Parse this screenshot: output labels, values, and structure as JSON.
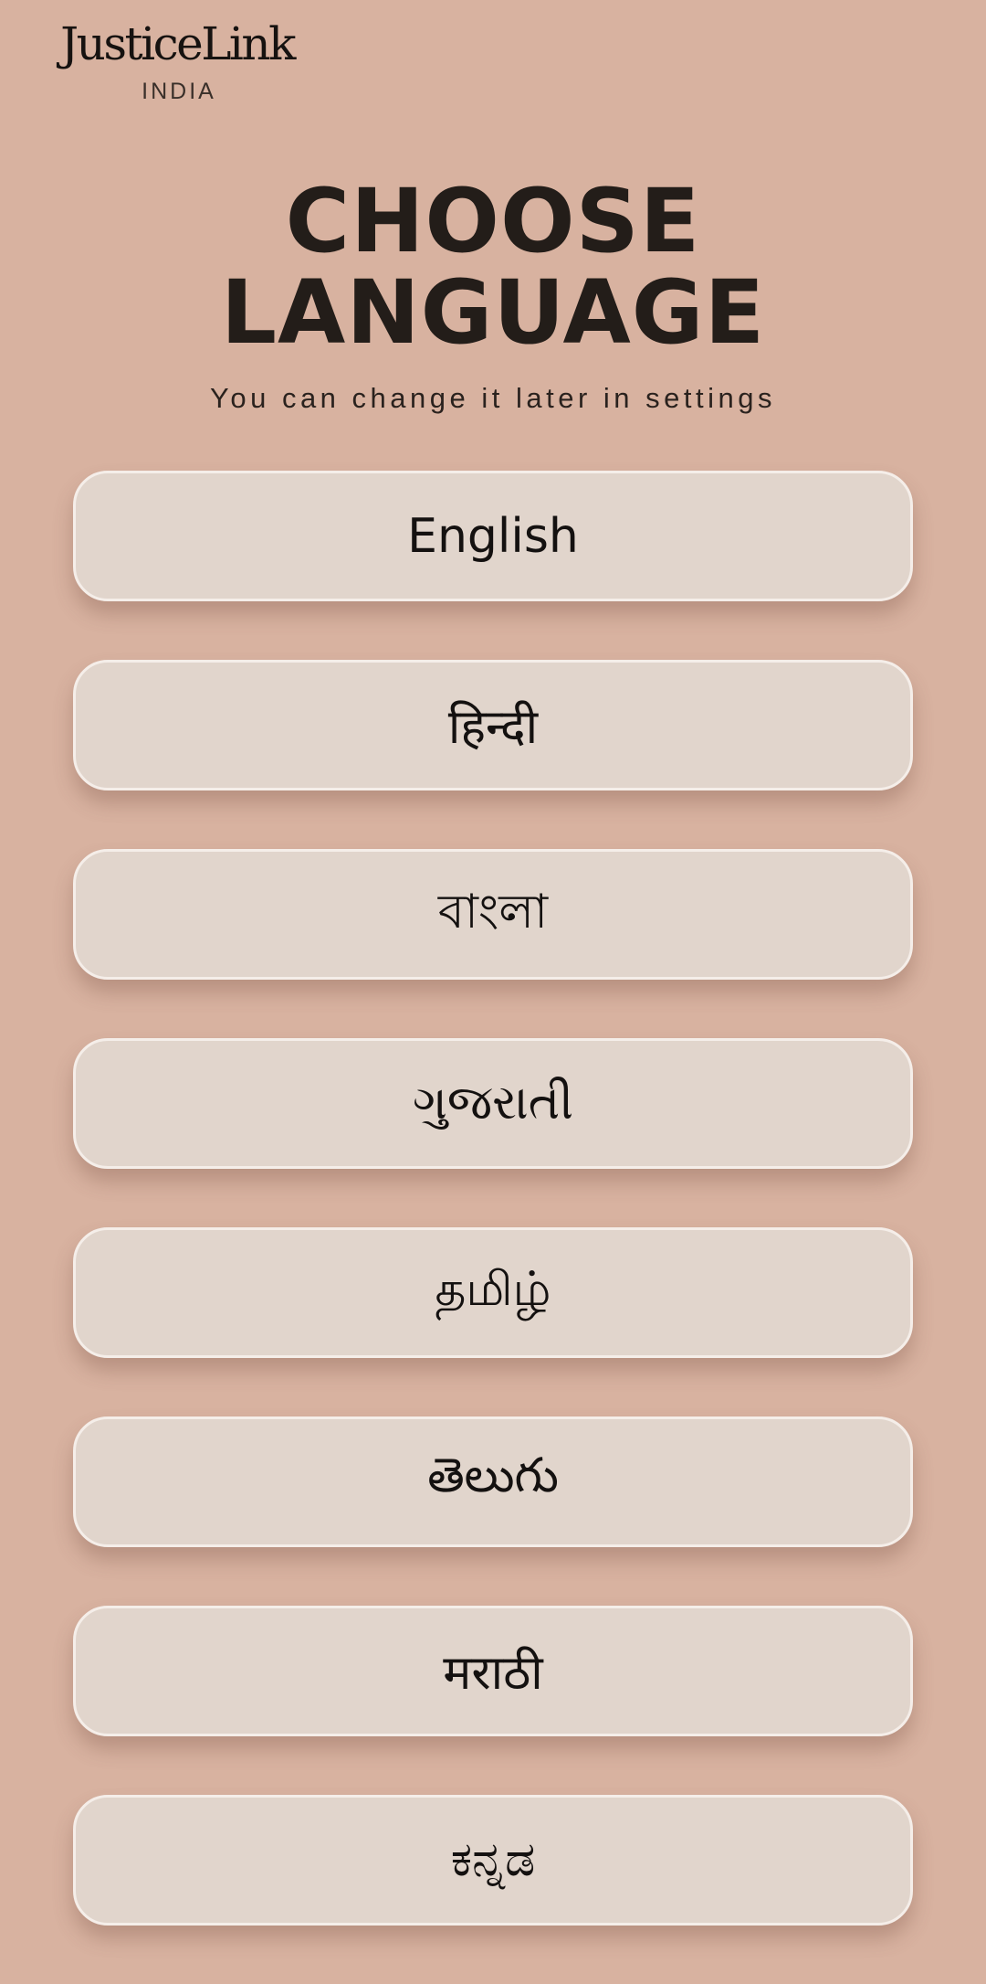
{
  "brand": {
    "name": "JusticeLink",
    "subtitle": "INDIA"
  },
  "header": {
    "title_line1": "CHOOSE",
    "title_line2": "LANGUAGE",
    "subtitle": "You can change it later in settings"
  },
  "languages": [
    {
      "label": "English"
    },
    {
      "label": "हिन्दी"
    },
    {
      "label": "বাংলা"
    },
    {
      "label": "ગુજરાતી"
    },
    {
      "label": "தமிழ்"
    },
    {
      "label": "తెలుగు"
    },
    {
      "label": "मराठी"
    },
    {
      "label": "ಕನ್ನಡ"
    }
  ],
  "colors": {
    "background": "#d8b2a0",
    "button_fill": "#e1d5cc",
    "button_border": "#f5eee9",
    "text": "#221c18"
  }
}
